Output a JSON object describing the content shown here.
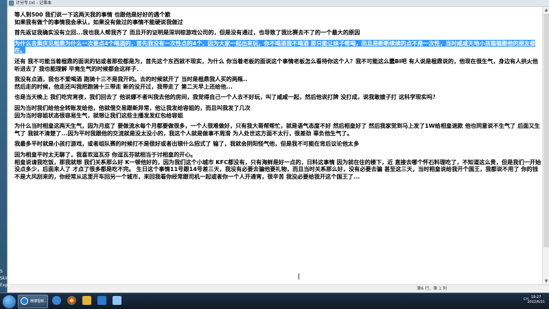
{
  "window": {
    "title": "计分专.txt - 记事本"
  },
  "desktop": {
    "labels": [
      "S",
      "Skin",
      "Expo"
    ]
  },
  "document": {
    "lines": [
      {
        "text": "等人到500 我们说一下这两天我的事情 也跟他是好好的遇个歉",
        "hl": false
      },
      {
        "text": "如果我有做个的事情我会承认，如果没有做过的事情不能硬说我做过",
        "hl": false
      },
      {
        "text": "",
        "hl": false
      },
      {
        "text": "首先返证我确实没有立回...我也我人帮我齐了 而且开的证明是深圳棕游戏公司的，但是没有通过，也导致了我比赛去不了的一个最大的原因",
        "hl": false
      },
      {
        "text": "",
        "hl": false
      },
      {
        "text": "为什么去乘庆见棍鼎为什么一次要点4个喝酒的，首先我没有一次性点的4个，因为大家一起出来玩，你不喝酒我不喝酒 那只能让妹子帮喝，而且是断断续续的点不是一次性，当时咸咸天地小孩猫猫跟他的朋友都在。",
        "hl": true
      },
      {
        "text": "",
        "hl": false
      },
      {
        "text": "还有 我不可能当着棍鼎的面说的钻或者那些都是为，首先这个东西就不现实，为什么 你当着老板的面说这个事情老板怎么看待你这个人？我不可能这么蠢BI吧 有人说是棍鼎说的，他现在很生气，身边有人拱火他听进去了 我也能理解 毕竟生气的时候都会这样子．",
        "hl": false
      },
      {
        "text": "",
        "hl": false
      },
      {
        "text": "我没有点酒，我也不爱喝酒 跑骑十三不是我开的。去的时候就开了 当时是棍鼎我人买的两瓶..",
        "hl": false
      },
      {
        "text": "然后走的时候，他走还叫我把跑骑十三带走 新的没开过，我带走了 第二天早上还给他...",
        "hl": false
      },
      {
        "text": "",
        "hl": false
      },
      {
        "text": "也是当天晚上 我们吃完宵夜，我们回去了 他说娜不者叫我去他的房间，我觉得自己一个人去不好玩，叫了咸咸一起，然后他说打牌 没打成，说我敢嫂子打 这科学现实吗？",
        "hl": false
      },
      {
        "text": "",
        "hl": false
      },
      {
        "text": "因为当时我们给他全转账发给他，他就借交易跟新异常，他让我发给容姐的，而且叫我发了几次",
        "hl": false
      },
      {
        "text": "因为当时容姐状态很容易生气，就想让我们这些主播发发红包给容姐",
        "hl": false
      },
      {
        "text": "",
        "hl": false
      },
      {
        "text": "为什么当时相皇这两天生气，因为月底了 要做流水每个月都要做很多，一个人很难做好，只有我大哥帮帮忙，就是语气态度不好 然后相皇好了 然后我家觉到马上发了1W给相皇退款 他也同意说不生气了 后面又生气了 我就不清楚了...因为平时我跟他的交流就是没太没小的，我这个人就是做事不周滑 为人处世这方面不太行，很差劲 辜负他生气了。",
        "hl": false
      },
      {
        "text": "",
        "hl": false
      },
      {
        "text": "我最多平时就是小孩打游戏，或者组队赛的时候打不是很好或者出错什么招式了 输了，我就会阴阳怪气他，但是我不可能在背后议论他太多",
        "hl": false
      },
      {
        "text": "",
        "hl": false
      },
      {
        "text": "因为相皇平时太无聊了，我喜欢逗瓦芬 你逗瓦芬就相当于讨相皇的开心。",
        "hl": false
      },
      {
        "text": "相皇说请我吃饭，那我就想 我们关系那么好 K一顿他好的，因为我们这个小城市 KFC都没有，只有海鲜是好一点的，日料这事情 因为就在住的楼下，近 直接去哪个怀石料理吃了，不知道这么贵，但是我们一开始没点多少，后面来人了 才点了很多都是吃不完。 生日这个事情11号跟14号差三天，我没有必要去骗他要礼物，而且当时关系那么好，没有必要去骗 甚至这三天，当时相皇说给我开个国王，我都说不用了 你的钱不是大风刮来的，你经常从这里开车回另一个城市，来回我看你经常跟司机一起或者你一个人开通宵，很辛苦 我没必要给我开这个国王了...",
        "hl": false
      }
    ]
  },
  "status": {
    "position": "第6 行，第 1 列"
  },
  "taskbar": {
    "active_app": "微博视频...",
    "tray_text": "CH",
    "time": "19:27",
    "date": "2022/6/21"
  }
}
